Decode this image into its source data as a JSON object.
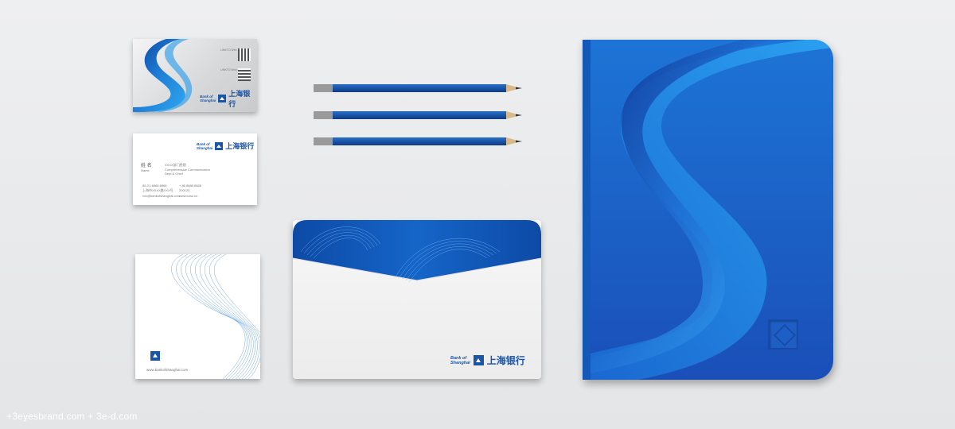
{
  "brand": {
    "name_en_line1": "Bank of",
    "name_en_line2": "Shanghai",
    "name_cn": "上海银行"
  },
  "card_back": {
    "qr_label_1": "LINKTO Wsh",
    "qr_label_2": "LINKTO Wsh"
  },
  "card_front": {
    "person_name": "姓  名",
    "person_name_en": "Name",
    "department": "XXXX部门经理",
    "title_line1": "Comprehensive Communication",
    "title_line2": "Dept & Chief",
    "phone": "86-21-6868 6868",
    "mobile": "+ 86 8888 8888",
    "address": "上海市XXXX路XXX号",
    "postcode": "200120",
    "email": "xxx@bankofshanghai.com",
    "website": "www.bosc.cn"
  },
  "note_card": {
    "url": "www.bankofshanghai.com"
  },
  "footer": {
    "credit": "+3eyesbrand.com + 3e-d.com"
  },
  "colors": {
    "primary_blue": "#1a55a8",
    "light_blue": "#1e88d8",
    "background": "#e7e8ea"
  }
}
